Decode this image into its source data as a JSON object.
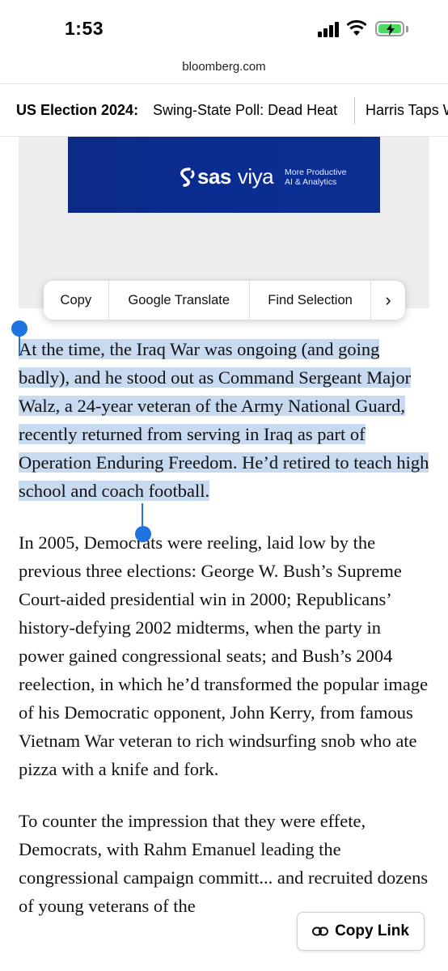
{
  "status_bar": {
    "time": "1:53"
  },
  "browser": {
    "url": "bloomberg.com"
  },
  "ticker": {
    "label": "US Election 2024:",
    "items": [
      "Swing-State Poll: Dead Heat",
      "Harris Taps W"
    ]
  },
  "ad": {
    "brand": "sas",
    "product": "viya",
    "tagline": [
      "More Productive",
      "AI & Analytics"
    ]
  },
  "context_menu": {
    "items": [
      "Copy",
      "Google Translate",
      "Find Selection"
    ],
    "more_icon": "chevron-right-icon"
  },
  "article": {
    "paragraphs": [
      "At the time, the Iraq War was ongoing (and going badly), and he stood out as Command Sergeant Major Walz, a 24-year veteran of the Army National Guard, recently returned from serving in Iraq as part of Operation Enduring Freedom. He’d retired to teach high school and coach football.",
      "In 2005, Democrats were reeling, laid low by the previous three elections: George W. Bush’s Supreme Court-aided presidential win in 2000; Republicans’ history-defying 2002 midterms, when the party in power gained congressional seats; and Bush’s 2004 reelection, in which he’d transformed the popular image of his Democratic opponent, John Kerry, from famous Vietnam War veteran to rich windsurfing snob who ate pizza with a knife and fork.",
      "To counter the impression that they were effete, Democrats, with Rahm Emanuel leading the congressional campaign committ... and recruited dozens of young veterans of the"
    ]
  },
  "copy_link": {
    "label": "Copy Link",
    "icon": "link-icon"
  },
  "colors": {
    "selection": "#c8daef",
    "handle": "#1f73e0",
    "ad_background": "#0b2c8e",
    "battery": "#4cd964"
  }
}
